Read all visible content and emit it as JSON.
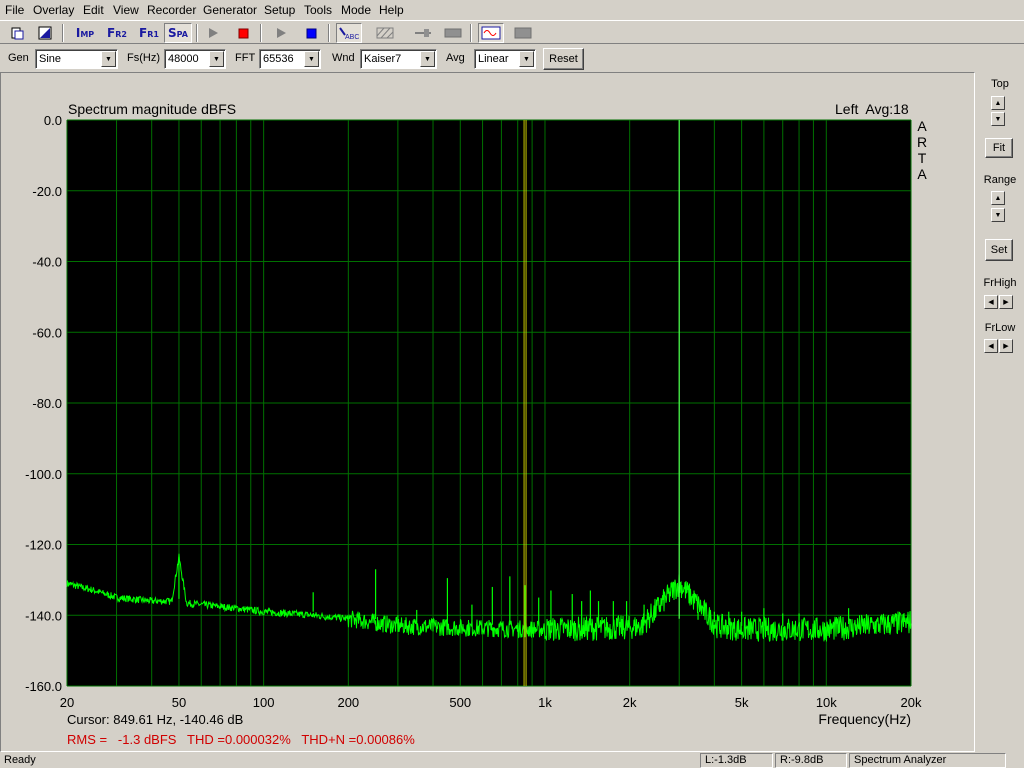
{
  "menu": [
    "File",
    "Overlay",
    "Edit",
    "View",
    "Recorder",
    "Generator",
    "Setup",
    "Tools",
    "Mode",
    "Help"
  ],
  "toolbar": {
    "imp": {
      "big": "I",
      "small": "MP"
    },
    "fr2": {
      "big": "F",
      "small": "R2"
    },
    "fr1": {
      "big": "F",
      "small": "R1"
    },
    "spa": {
      "big": "S",
      "small": "PA"
    }
  },
  "controls": {
    "gen_label": "Gen",
    "gen_value": "Sine",
    "fs_label": "Fs(Hz)",
    "fs_value": "48000",
    "fft_label": "FFT",
    "fft_value": "65536",
    "wnd_label": "Wnd",
    "wnd_value": "Kaiser7",
    "avg_label": "Avg",
    "avg_value": "Linear",
    "reset": "Reset"
  },
  "chart": {
    "title": "Spectrum magnitude dBFS",
    "channel": "Left  Avg:18",
    "watermark": [
      "A",
      "R",
      "T",
      "A"
    ],
    "y_ticks": [
      "0.0",
      "-20.0",
      "-40.0",
      "-60.0",
      "-80.0",
      "-100.0",
      "-120.0",
      "-140.0",
      "-160.0"
    ],
    "x_ticks": [
      "20",
      "50",
      "100",
      "200",
      "500",
      "1k",
      "2k",
      "5k",
      "10k",
      "20k"
    ],
    "cursor": "Cursor: 849.61 Hz, -140.46 dB",
    "xlabel": "Frequency(Hz)",
    "measure": "RMS =   -1.3 dBFS   THD =0.000032%   THD+N =0.00086%",
    "colors": {
      "bg": "#000000",
      "grid": "#007000",
      "trace": "#00ff00",
      "cursor": "#c8c800",
      "fund": "#50ff50",
      "measure": "#d00000"
    }
  },
  "chart_data": {
    "type": "line",
    "title": "Spectrum magnitude dBFS",
    "xlabel": "Frequency(Hz)",
    "ylabel": "",
    "xscale": "log",
    "xlim": [
      20,
      20000
    ],
    "ylim": [
      -160,
      0
    ],
    "grid": true,
    "series": [
      {
        "name": "Left",
        "color": "#00ff00"
      }
    ],
    "noise_floor": {
      "x": [
        20,
        25,
        30,
        40,
        45,
        60,
        80,
        100,
        150,
        200,
        300,
        500,
        1000,
        2000,
        2700,
        3300,
        5000,
        10000,
        20000
      ],
      "y": [
        -131,
        -133,
        -135,
        -136,
        -136,
        -137,
        -138,
        -139,
        -140,
        -141,
        -143,
        -143.5,
        -144,
        -143.5,
        -142,
        -142,
        -144,
        -144,
        -142
      ]
    },
    "peaks": [
      {
        "f": 50,
        "db": -123.5
      },
      {
        "f": 150,
        "db": -133.5
      },
      {
        "f": 250,
        "db": -127
      },
      {
        "f": 300,
        "db": -140
      },
      {
        "f": 350,
        "db": -138.5
      },
      {
        "f": 450,
        "db": -129.5
      },
      {
        "f": 550,
        "db": -137
      },
      {
        "f": 650,
        "db": -132
      },
      {
        "f": 750,
        "db": -129
      },
      {
        "f": 850,
        "db": -131.5
      },
      {
        "f": 950,
        "db": -135
      },
      {
        "f": 1050,
        "db": -133
      },
      {
        "f": 1250,
        "db": -134
      },
      {
        "f": 1350,
        "db": -136
      },
      {
        "f": 1450,
        "db": -133
      },
      {
        "f": 1550,
        "db": -136
      },
      {
        "f": 1750,
        "db": -136
      },
      {
        "f": 1950,
        "db": -136
      },
      {
        "f": 2250,
        "db": -137
      },
      {
        "f": 2450,
        "db": -137.5
      },
      {
        "f": 3000,
        "db": 0
      },
      {
        "f": 3500,
        "db": -139
      },
      {
        "f": 4000,
        "db": -139
      },
      {
        "f": 4500,
        "db": -139
      },
      {
        "f": 5000,
        "db": -139
      },
      {
        "f": 6000,
        "db": -138
      },
      {
        "f": 7000,
        "db": -139.5
      },
      {
        "f": 8000,
        "db": -139.5
      },
      {
        "f": 12000,
        "db": -138
      }
    ],
    "cursor": {
      "x": 849.61,
      "y": -140.46
    }
  },
  "right_panel": {
    "top": "Top",
    "fit": "Fit",
    "range": "Range",
    "set": "Set",
    "frhigh": "FrHigh",
    "frlow": "FrLow"
  },
  "status": {
    "ready": "Ready",
    "left": "L:-1.3dB",
    "right": "R:-9.8dB",
    "mode": "Spectrum Analyzer"
  }
}
